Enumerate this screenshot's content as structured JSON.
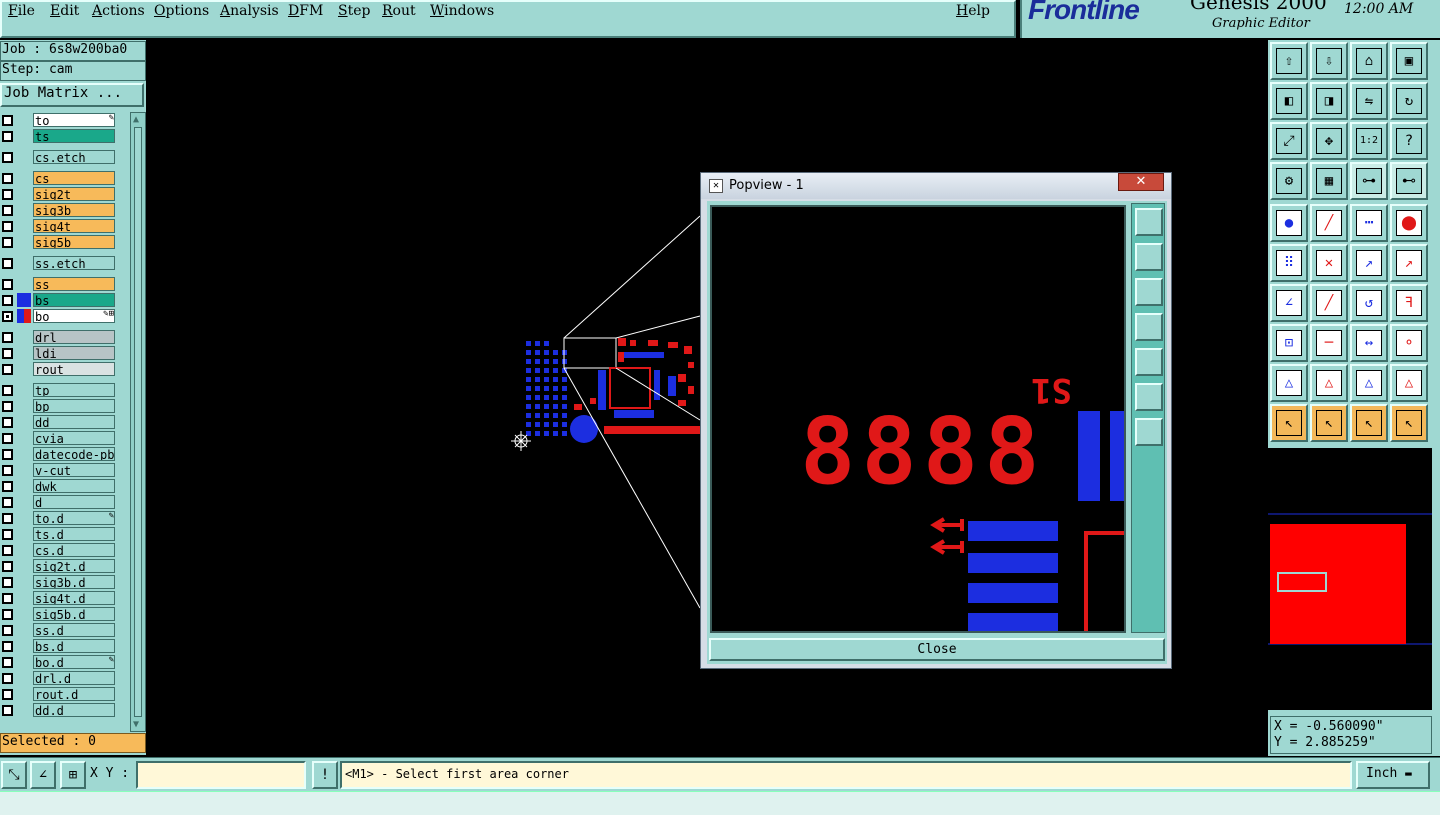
{
  "menu": {
    "items": [
      {
        "label": "File",
        "u": "F"
      },
      {
        "label": "Edit",
        "u": "E"
      },
      {
        "label": "Actions",
        "u": "A"
      },
      {
        "label": "Options",
        "u": "O"
      },
      {
        "label": "Analysis",
        "u": "A"
      },
      {
        "label": "DFM",
        "u": "D"
      },
      {
        "label": "Step",
        "u": "S"
      },
      {
        "label": "Rout",
        "u": "R"
      },
      {
        "label": "Windows",
        "u": "W"
      }
    ],
    "help": "Help"
  },
  "brand": {
    "logo_a": "F",
    "logo_b": "rontline",
    "product": "Genesis 2000",
    "subtitle": "Graphic Editor",
    "clock": "12:00 AM"
  },
  "job": {
    "job_line": "Job : 6s8w200ba0",
    "step_line": "Step: cam",
    "matrix_button": "Job Matrix ..."
  },
  "layers": [
    {
      "name": "to",
      "color": "#ffffff",
      "pen": "✎"
    },
    {
      "name": "ts",
      "color": "#1aa88a"
    },
    {
      "name": "cs.etch",
      "color": "#9fd8d2",
      "gap": true
    },
    {
      "name": "cs",
      "color": "#f7ba5a",
      "gap": true
    },
    {
      "name": "sig2t",
      "color": "#f7ba5a"
    },
    {
      "name": "sig3b",
      "color": "#f7ba5a"
    },
    {
      "name": "sig4t",
      "color": "#f7ba5a"
    },
    {
      "name": "sig5b",
      "color": "#f7ba5a"
    },
    {
      "name": "ss.etch",
      "color": "#9fd8d2",
      "gap": true
    },
    {
      "name": "ss",
      "color": "#f7ba5a",
      "gap": true
    },
    {
      "name": "bs",
      "color": "#1aa88a",
      "swatch": "#1c2ee0"
    },
    {
      "name": "bo",
      "color": "#ffffff",
      "swatch": "#1c2ee0",
      "swatch2": "#e01818",
      "pen": "✎⊞",
      "checked": true
    },
    {
      "name": "drl",
      "color": "#b7c4c6",
      "gap": true
    },
    {
      "name": "ldi",
      "color": "#b7c4c6"
    },
    {
      "name": "rout",
      "color": "#d9e2e2"
    },
    {
      "name": "tp",
      "color": "#9fd8d2",
      "gap": true
    },
    {
      "name": "bp",
      "color": "#9fd8d2"
    },
    {
      "name": "dd",
      "color": "#9fd8d2"
    },
    {
      "name": "cvia",
      "color": "#9fd8d2"
    },
    {
      "name": "datecode-pbc",
      "color": "#9fd8d2"
    },
    {
      "name": "v-cut",
      "color": "#9fd8d2"
    },
    {
      "name": "dwk",
      "color": "#9fd8d2"
    },
    {
      "name": "d",
      "color": "#9fd8d2"
    },
    {
      "name": "to.d",
      "color": "#9fd8d2",
      "pen": "✎"
    },
    {
      "name": "ts.d",
      "color": "#9fd8d2"
    },
    {
      "name": "cs.d",
      "color": "#9fd8d2"
    },
    {
      "name": "sig2t.d",
      "color": "#9fd8d2"
    },
    {
      "name": "sig3b.d",
      "color": "#9fd8d2"
    },
    {
      "name": "sig4t.d",
      "color": "#9fd8d2"
    },
    {
      "name": "sig5b.d",
      "color": "#9fd8d2"
    },
    {
      "name": "ss.d",
      "color": "#9fd8d2"
    },
    {
      "name": "bs.d",
      "color": "#9fd8d2"
    },
    {
      "name": "bo.d",
      "color": "#9fd8d2",
      "pen": "✎"
    },
    {
      "name": "drl.d",
      "color": "#9fd8d2"
    },
    {
      "name": "rout.d",
      "color": "#9fd8d2"
    },
    {
      "name": "dd.d",
      "color": "#9fd8d2"
    }
  ],
  "selected": "Selected : 0",
  "popup": {
    "title": "Popview - 1",
    "close_x": "✕",
    "close_button": "Close",
    "pcb_text": "8888",
    "silk_mark": "S1"
  },
  "coords": {
    "x": "X = -0.560090\"",
    "y": "Y = 2.885259\""
  },
  "bottom": {
    "xy_label": "X Y :",
    "xy_value": "",
    "bang": "!",
    "prompt": "<M1> - Select first area corner",
    "units": "Inch"
  },
  "toolbar_icons": [
    "zoom-home-icon",
    "zoom-out-icon",
    "home-icon",
    "fit-window-icon",
    "pan-left-icon",
    "pan-right-icon",
    "mirror-icon",
    "redraw-icon",
    "zoom-fit-icon",
    "zoom-center-icon",
    "scale-1-2-icon",
    "help-icon",
    "settings-icon",
    "grid-icon",
    "layer-toggle-icon",
    "layer-toggle2-icon",
    "add-pad-icon",
    "add-line-icon",
    "measure-icon",
    "pad-icon",
    "connect-icon",
    "delete-icon",
    "move-icon",
    "copy-icon",
    "edit-line-icon",
    "edit-line2-icon",
    "rotate-icon",
    "mirror-text-icon",
    "move-pad-icon",
    "split-icon",
    "stretch-icon",
    "group-icon",
    "angle-icon",
    "angle2-icon",
    "angle3-icon",
    "angle4-icon",
    "select-arrow-icon",
    "select-box-icon",
    "select-lasso-icon",
    "select-multi-icon"
  ]
}
